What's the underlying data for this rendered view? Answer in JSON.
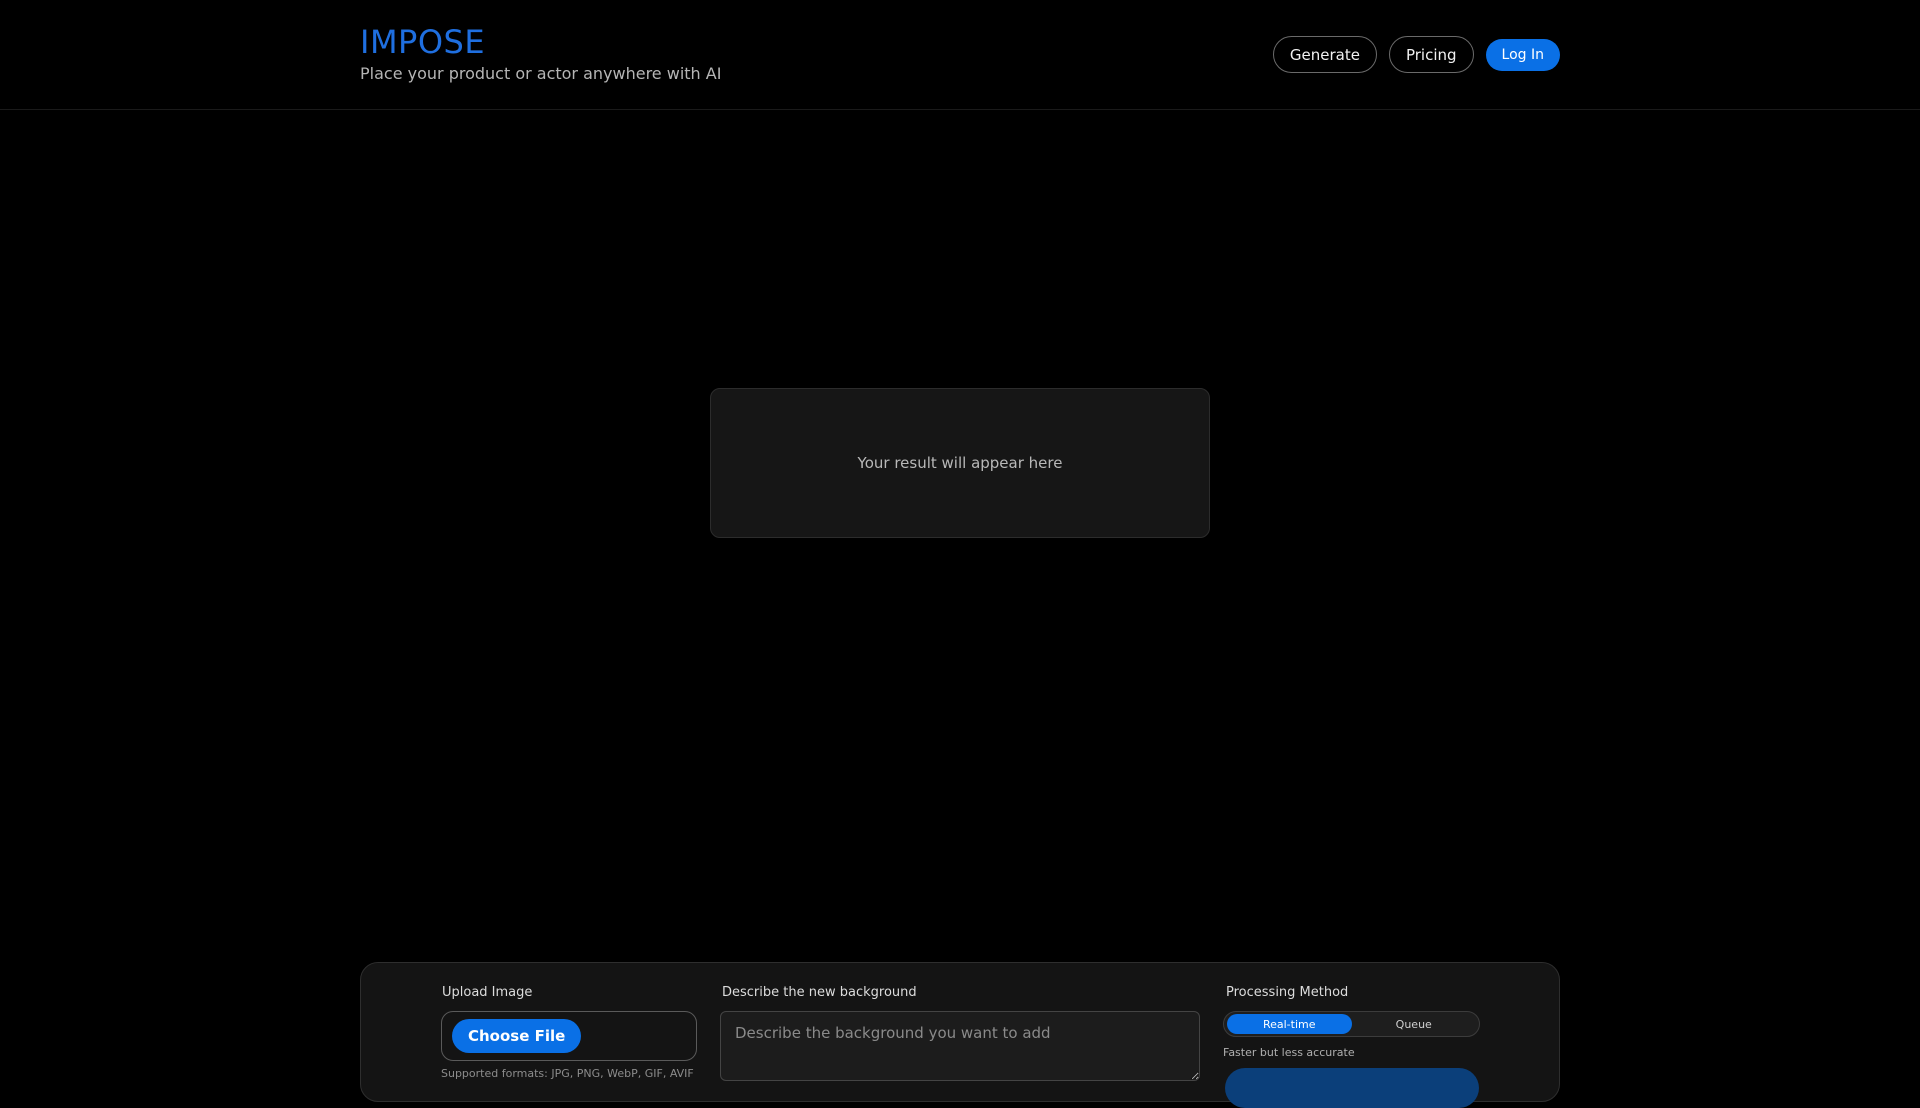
{
  "brand": {
    "title": "IMPOSE",
    "tagline": "Place your product or actor anywhere with AI"
  },
  "nav": {
    "generate_label": "Generate",
    "pricing_label": "Pricing",
    "login_label": "Log In"
  },
  "result": {
    "placeholder": "Your result will appear here"
  },
  "panel": {
    "upload": {
      "label": "Upload Image",
      "button_label": "Choose File",
      "formats": "Supported formats: JPG, PNG, WebP, GIF, AVIF"
    },
    "background": {
      "label": "Describe the new background",
      "placeholder": "Describe the background you want to add",
      "value": ""
    },
    "processing": {
      "label": "Processing Method",
      "options": [
        "Real-time",
        "Queue"
      ],
      "selected": "Real-time",
      "hint": "Faster but less accurate"
    }
  },
  "colors": {
    "accent": "#0a70e6",
    "brand": "#1f6fe0",
    "background": "#000000",
    "panel": "#141414"
  }
}
